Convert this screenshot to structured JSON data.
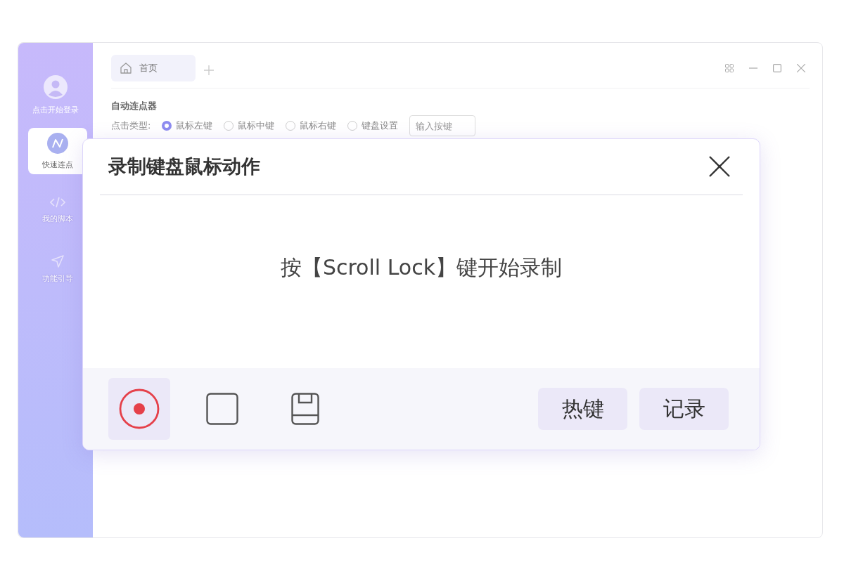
{
  "sidebar": {
    "login_label": "点击开始登录",
    "items": [
      {
        "kind": "clicker",
        "label": "快速连点",
        "selected": true
      },
      {
        "kind": "script",
        "label": "我的脚本",
        "selected": false
      },
      {
        "kind": "guide",
        "label": "功能引导",
        "selected": false
      }
    ]
  },
  "tabs": [
    {
      "label": "首页",
      "selected": true
    }
  ],
  "section_title": "自动连点器",
  "click_type": {
    "label": "点击类型:",
    "options": [
      {
        "label": "鼠标左键",
        "selected": true
      },
      {
        "label": "鼠标中键",
        "selected": false
      },
      {
        "label": "鼠标右键",
        "selected": false
      },
      {
        "label": "键盘设置",
        "selected": false
      }
    ],
    "key_input": {
      "placeholder": "输入按键"
    }
  },
  "dialog": {
    "title": "录制键盘鼠标动作",
    "message": "按【Scroll Lock】键开始录制",
    "tools": [
      {
        "kind": "record",
        "selected": true
      },
      {
        "kind": "stop",
        "selected": false
      },
      {
        "kind": "save",
        "selected": false
      }
    ],
    "buttons": [
      "热键",
      "记录"
    ]
  }
}
